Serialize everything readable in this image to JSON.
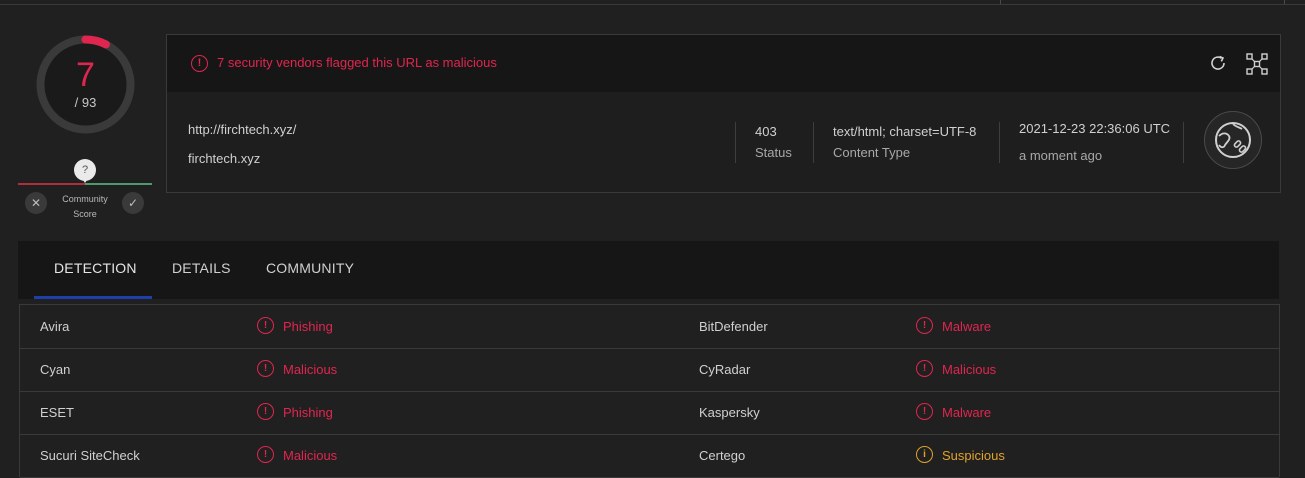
{
  "score": {
    "detections": "7",
    "total": "/ 93",
    "fraction": 0.075
  },
  "community": {
    "marker": "?",
    "label": "Community Score",
    "down_glyph": "✕",
    "up_glyph": "✓"
  },
  "alert": {
    "icon_glyph": "!",
    "text": "7 security vendors flagged this URL as malicious"
  },
  "url": {
    "full": "http://firchtech.xyz/",
    "host": "firchtech.xyz"
  },
  "meta": {
    "status_value": "403",
    "status_label": "Status",
    "content_type_value": "text/html; charset=UTF-8",
    "content_type_label": "Content Type",
    "date_value": "2021-12-23 22:36:06 UTC",
    "date_label": "a moment ago"
  },
  "tabs": [
    {
      "label": "DETECTION"
    },
    {
      "label": "DETAILS"
    },
    {
      "label": "COMMUNITY"
    }
  ],
  "detections": [
    {
      "left": {
        "vendor": "Avira",
        "result": "Phishing",
        "type": "malicious"
      },
      "right": {
        "vendor": "BitDefender",
        "result": "Malware",
        "type": "malicious"
      }
    },
    {
      "left": {
        "vendor": "Cyan",
        "result": "Malicious",
        "type": "malicious"
      },
      "right": {
        "vendor": "CyRadar",
        "result": "Malicious",
        "type": "malicious"
      }
    },
    {
      "left": {
        "vendor": "ESET",
        "result": "Phishing",
        "type": "malicious"
      },
      "right": {
        "vendor": "Kaspersky",
        "result": "Malware",
        "type": "malicious"
      }
    },
    {
      "left": {
        "vendor": "Sucuri SiteCheck",
        "result": "Malicious",
        "type": "malicious"
      },
      "right": {
        "vendor": "Certego",
        "result": "Suspicious",
        "type": "suspicious"
      }
    }
  ],
  "colors": {
    "malicious": "#e0264f",
    "suspicious": "#e2a22a",
    "tab_accent": "#1e3ea8"
  }
}
